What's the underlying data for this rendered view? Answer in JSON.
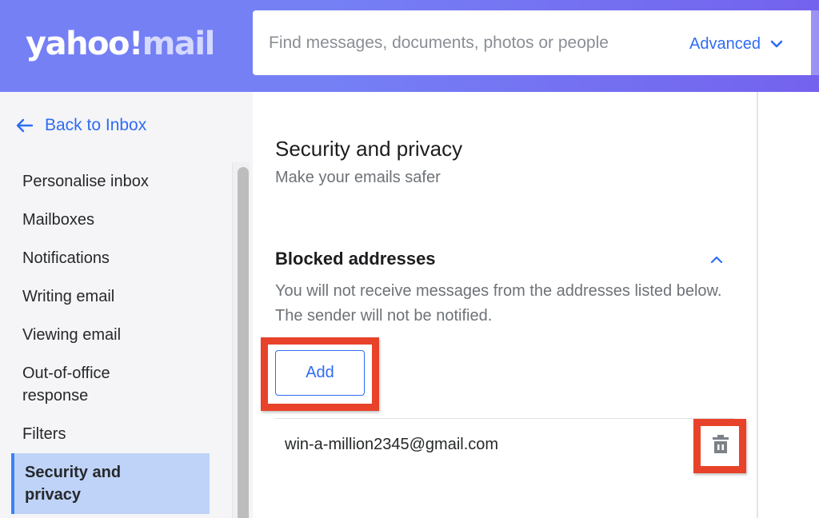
{
  "header": {
    "logo_primary": "yahoo!",
    "logo_secondary": "mail",
    "search_placeholder": "Find messages, documents, photos or people",
    "advanced_label": "Advanced",
    "advanced_icon": "chevron-down-icon"
  },
  "sidebar": {
    "back_label": "Back to Inbox",
    "back_icon": "arrow-left-icon",
    "items": [
      {
        "label": "Personalise inbox",
        "active": false
      },
      {
        "label": "Mailboxes",
        "active": false
      },
      {
        "label": "Notifications",
        "active": false
      },
      {
        "label": "Writing email",
        "active": false
      },
      {
        "label": "Viewing email",
        "active": false
      },
      {
        "label": "Out-of-office response",
        "active": false
      },
      {
        "label": "Filters",
        "active": false
      },
      {
        "label": "Security and privacy",
        "active": true
      }
    ]
  },
  "main": {
    "title": "Security and privacy",
    "subtitle": "Make your emails safer",
    "section": {
      "title": "Blocked addresses",
      "collapse_icon": "chevron-up-icon",
      "description": "You will not receive messages from the addresses listed below. The sender will not be notified.",
      "add_label": "Add",
      "blocked": [
        {
          "email": "win-a-million2345@gmail.com",
          "action_icon": "trash-icon"
        }
      ]
    }
  },
  "colors": {
    "header_gradient_start": "#7580f5",
    "header_gradient_end": "#7462ee",
    "accent_blue": "#2f6cf4",
    "active_nav_bg": "#bfd3f8",
    "highlight_red": "#e8432a"
  }
}
